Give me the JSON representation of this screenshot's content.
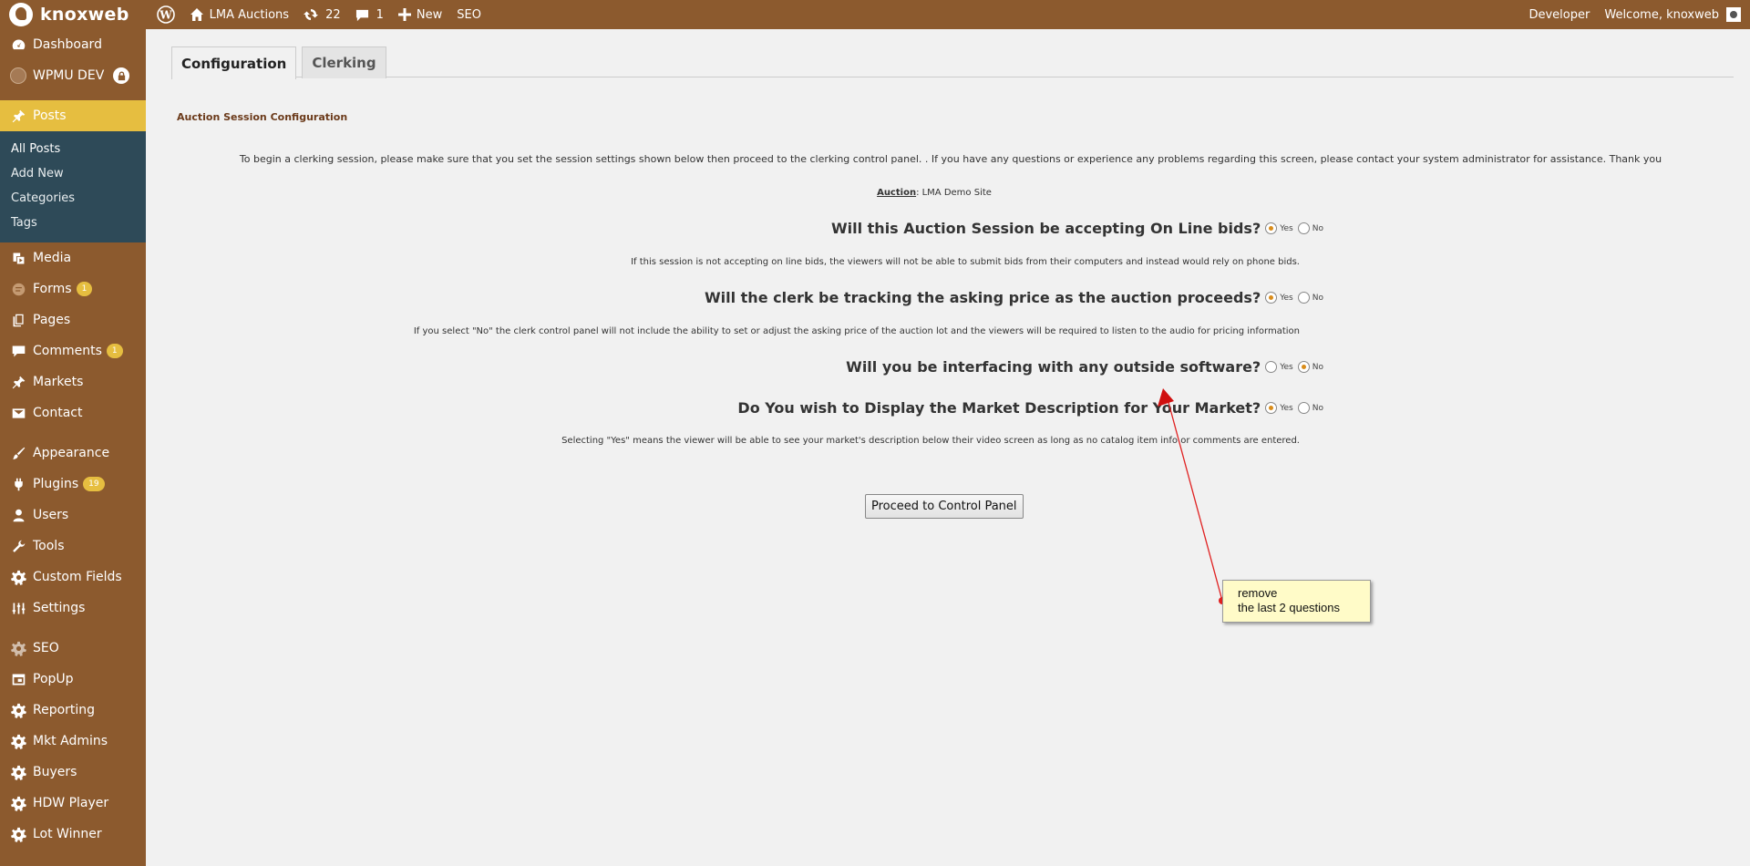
{
  "adminbar": {
    "site_name": "knoxweb",
    "site_link": "LMA Auctions",
    "updates_count": "22",
    "comments_count": "1",
    "new_label": "New",
    "seo_label": "SEO",
    "developer_label": "Developer",
    "welcome": "Welcome, knoxweb"
  },
  "sidebar": {
    "dashboard": "Dashboard",
    "wpmu": "WPMU DEV",
    "posts": "Posts",
    "posts_sub": [
      "All Posts",
      "Add New",
      "Categories",
      "Tags"
    ],
    "media": "Media",
    "forms": "Forms",
    "forms_badge": "1",
    "pages": "Pages",
    "comments": "Comments",
    "comments_badge": "1",
    "markets": "Markets",
    "contact": "Contact",
    "appearance": "Appearance",
    "plugins": "Plugins",
    "plugins_badge": "19",
    "users": "Users",
    "tools": "Tools",
    "custom_fields": "Custom Fields",
    "settings": "Settings",
    "seo": "SEO",
    "popup": "PopUp",
    "reporting": "Reporting",
    "mkt_admins": "Mkt Admins",
    "buyers": "Buyers",
    "hdw_player": "HDW Player",
    "lot_winner": "Lot Winner"
  },
  "tabs": [
    "Configuration",
    "Clerking"
  ],
  "main": {
    "section_title": "Auction Session Configuration",
    "intro": "To begin a clerking session, please make sure that you set the session settings shown below then proceed to the clerking control panel. . If you have any questions or experience any problems regarding this screen, please contact your system administrator for assistance. Thank you",
    "auction_label": "Auction",
    "auction_value": ": LMA Demo Site",
    "yes_label": "Yes",
    "no_label": "No",
    "questions": [
      {
        "text": "Will this Auction Session be accepting On Line bids?",
        "selected": "Yes",
        "note": "If this session is not accepting on line bids, the viewers will not be able to submit bids from their computers and instead would rely on phone bids."
      },
      {
        "text": "Will the clerk be tracking the asking price as the auction proceeds?",
        "selected": "Yes",
        "note": "If you select \"No\" the clerk control panel will not include the ability to set or adjust the asking price of the auction lot and the viewers will be required to listen to the audio for pricing information"
      },
      {
        "text": "Will you be interfacing with any outside software?",
        "selected": "No",
        "note": ""
      },
      {
        "text": "Do You wish to Display the Market Description for Your Market?",
        "selected": "Yes",
        "note": "Selecting \"Yes\" means the viewer will be able to see your market's description below their video screen as long as no catalog item info or comments are entered."
      }
    ],
    "proceed_button": "Proceed to Control Panel"
  },
  "annotation": {
    "line1": "remove",
    "line2": "the last 2 questions",
    "color": "#e02020"
  },
  "colors": {
    "menu_bg": "#8c5a2e",
    "current_item": "#e6be40",
    "submenu_bg": "#2e4a58"
  }
}
